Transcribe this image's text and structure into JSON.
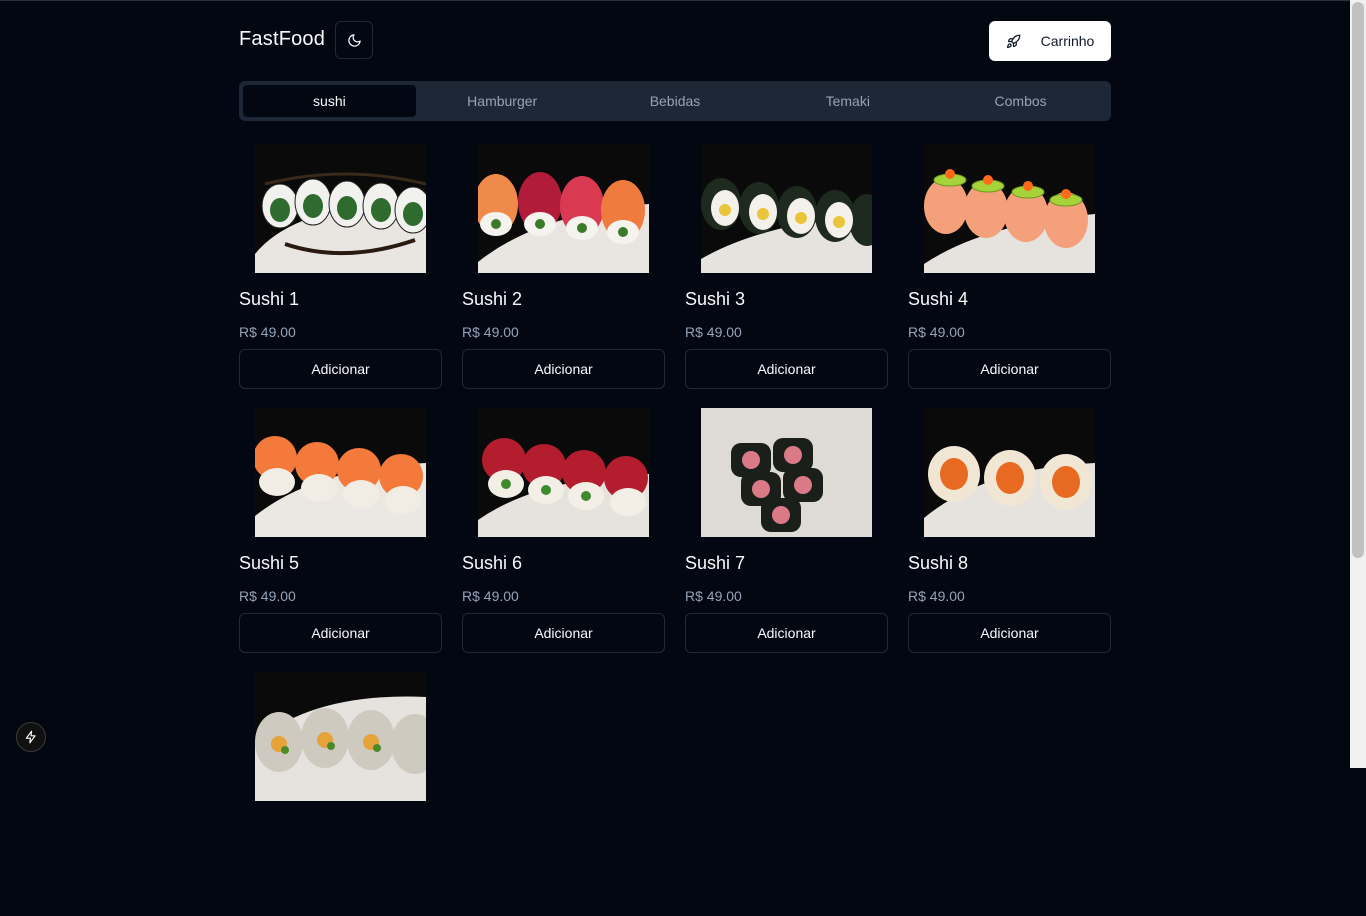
{
  "header": {
    "brand": "FastFood",
    "cart_label": "Carrinho",
    "theme_icon": "moon-icon",
    "cart_icon": "rocket-icon"
  },
  "tabs": [
    {
      "label": "sushi",
      "active": true
    },
    {
      "label": "Hamburger",
      "active": false
    },
    {
      "label": "Bebidas",
      "active": false
    },
    {
      "label": "Temaki",
      "active": false
    },
    {
      "label": "Combos",
      "active": false
    }
  ],
  "products": [
    {
      "name": "Sushi 1",
      "price": "R$ 49.00",
      "button": "Adicionar"
    },
    {
      "name": "Sushi 2",
      "price": "R$ 49.00",
      "button": "Adicionar"
    },
    {
      "name": "Sushi 3",
      "price": "R$ 49.00",
      "button": "Adicionar"
    },
    {
      "name": "Sushi 4",
      "price": "R$ 49.00",
      "button": "Adicionar"
    },
    {
      "name": "Sushi 5",
      "price": "R$ 49.00",
      "button": "Adicionar"
    },
    {
      "name": "Sushi 6",
      "price": "R$ 49.00",
      "button": "Adicionar"
    },
    {
      "name": "Sushi 7",
      "price": "R$ 49.00",
      "button": "Adicionar"
    },
    {
      "name": "Sushi 8",
      "price": "R$ 49.00",
      "button": "Adicionar"
    },
    {
      "name": "",
      "price": "",
      "button": ""
    }
  ],
  "colors": {
    "background": "#030712",
    "tabs_bg": "#1e2736",
    "border": "#1f2937",
    "muted_text": "#94a3b8"
  },
  "fab_icon": "lightning-icon"
}
